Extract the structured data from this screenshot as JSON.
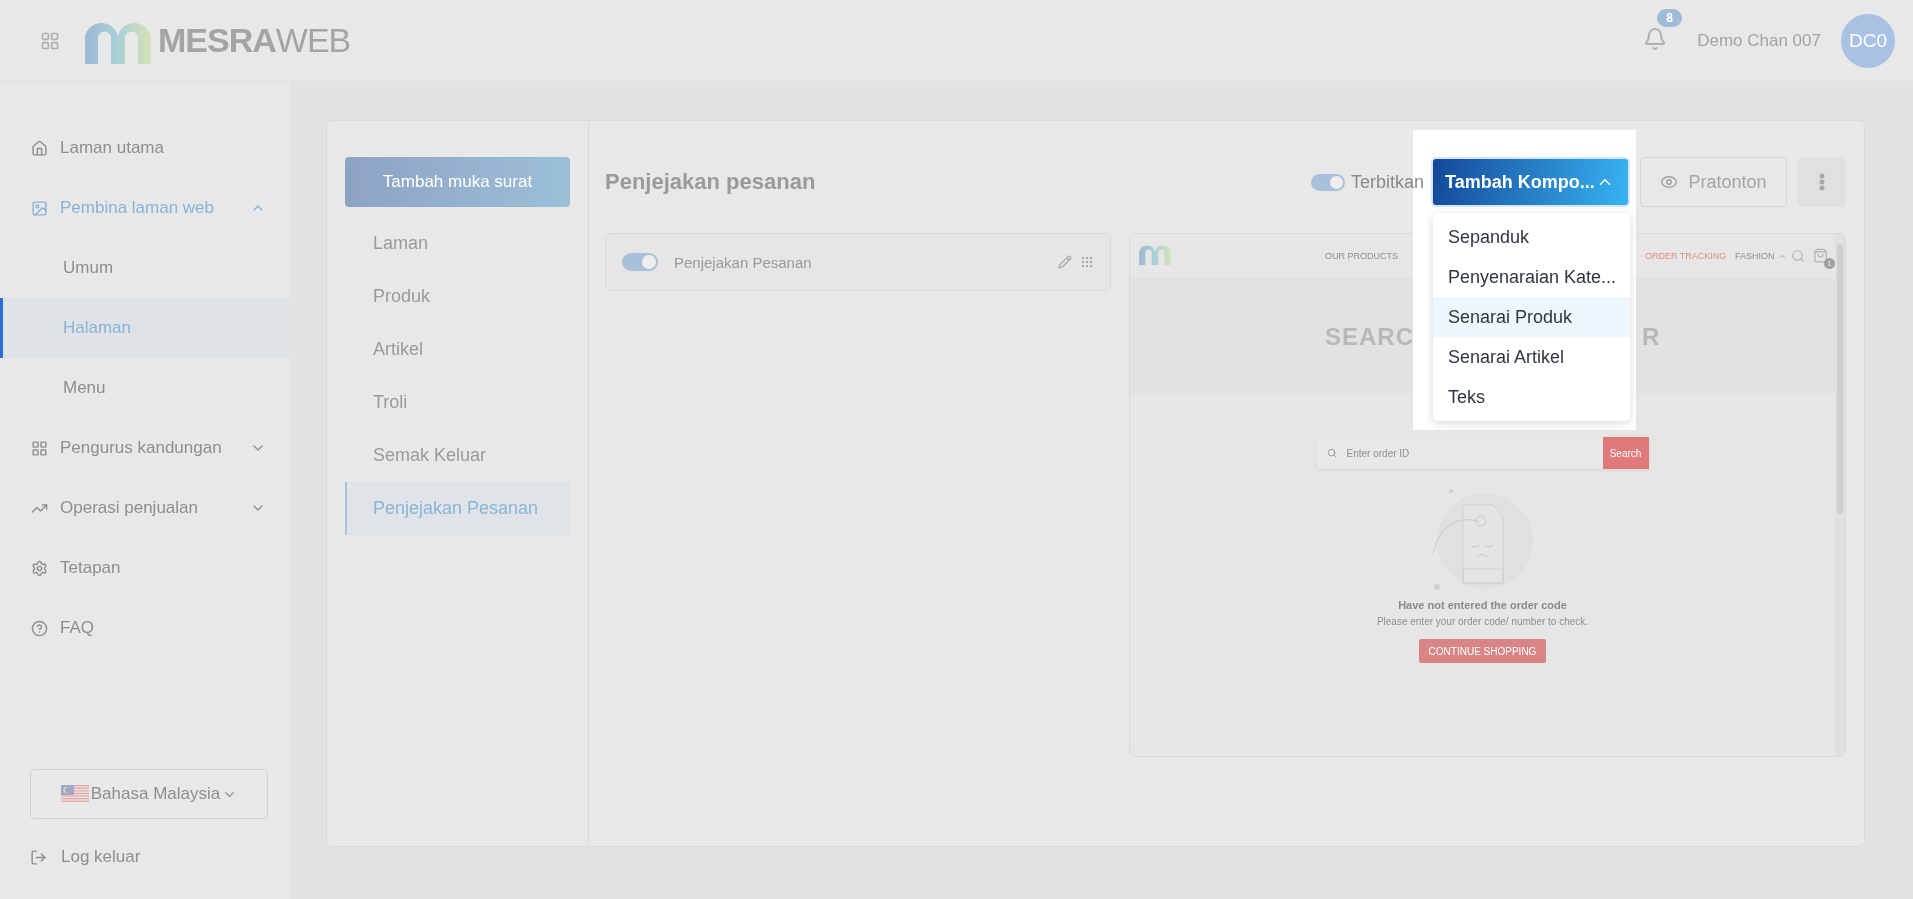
{
  "header": {
    "logo": "**MESRA**WEB",
    "notification_count": "8",
    "user_name": "Demo Chan 007",
    "avatar_initials": "DC0"
  },
  "sidebar": {
    "items": [
      {
        "label": "Laman utama",
        "selected": false
      },
      {
        "label": "Pembina laman web",
        "selected": false,
        "expanded": true,
        "children": [
          {
            "label": "Umum",
            "selected": false
          },
          {
            "label": "Halaman",
            "selected": true
          },
          {
            "label": "Menu",
            "selected": false
          }
        ]
      },
      {
        "label": "Pengurus kandungan",
        "selected": false,
        "expanded": false
      },
      {
        "label": "Operasi penjualan",
        "selected": false,
        "expanded": false
      },
      {
        "label": "Tetapan",
        "selected": false
      },
      {
        "label": "FAQ",
        "selected": false
      }
    ],
    "language": "Bahasa Malaysia",
    "logout": "Log keluar"
  },
  "pages": {
    "add_button": "Tambah muka surat",
    "items": [
      {
        "label": "Laman",
        "selected": false
      },
      {
        "label": "Produk",
        "selected": false
      },
      {
        "label": "Artikel",
        "selected": false
      },
      {
        "label": "Troli",
        "selected": false
      },
      {
        "label": "Semak Keluar",
        "selected": false
      },
      {
        "label": "Penjejakan Pesanan",
        "selected": true
      }
    ]
  },
  "editor": {
    "title": "Penjejakan pesanan",
    "publish": {
      "label": "Terbitkan",
      "on": true
    },
    "add_component": {
      "label": "Tambah Kompo...",
      "expanded": true,
      "options": [
        {
          "label": "Sepanduk",
          "selected": false
        },
        {
          "label": "Penyenaraian Kate...",
          "selected": false
        },
        {
          "label": "Senarai Produk",
          "selected": true
        },
        {
          "label": "Senarai Artikel",
          "selected": false
        },
        {
          "label": "Teks",
          "selected": false
        }
      ]
    },
    "preview_button": "Pratonton",
    "components": [
      {
        "label": "Penjejakan Pesanan",
        "on": true
      }
    ],
    "preview": {
      "nav": [
        {
          "label": "OUR PRODUCTS",
          "selected": false
        },
        {
          "label": "ORDER TRACKING",
          "selected": true
        },
        {
          "label": "FASHION",
          "selected": false
        }
      ],
      "cart_count": "1",
      "heading_parts": [
        "SEARC",
        "R"
      ],
      "search_placeholder": "Enter order ID",
      "search_button": "Search",
      "empty_title": "Have not entered the order code",
      "empty_text": "Please enter your order code/ number to check.",
      "continue_button": "CONTINUE SHOPPING"
    }
  }
}
